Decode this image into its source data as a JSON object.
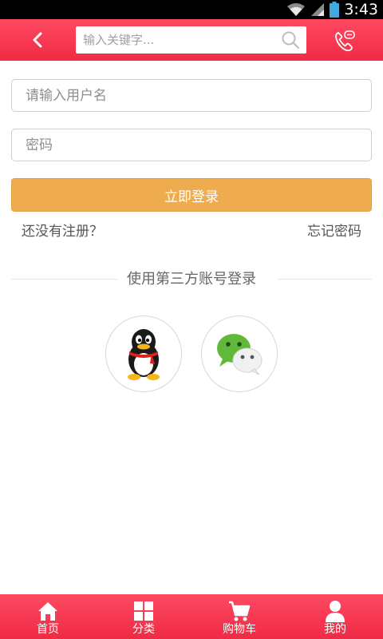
{
  "status_bar": {
    "time": "3:43"
  },
  "header": {
    "search_placeholder": "输入关键字...",
    "icons": [
      "back-arrow-icon",
      "search-icon",
      "phone-message-icon"
    ]
  },
  "form": {
    "username_placeholder": "请输入用户名",
    "password_placeholder": "密码",
    "login_label": "立即登录",
    "register_link": "还没有注册？",
    "forgot_link": "忘记密码"
  },
  "third_party": {
    "title": "使用第三方账号登录",
    "providers": [
      "qq-icon",
      "wechat-icon"
    ]
  },
  "bottom_nav": {
    "items": [
      {
        "label": "首页",
        "icon": "home-icon"
      },
      {
        "label": "分类",
        "icon": "category-grid-icon"
      },
      {
        "label": "购物车",
        "icon": "cart-icon"
      },
      {
        "label": "我的",
        "icon": "user-icon"
      }
    ]
  },
  "colors": {
    "header": "#f6354f",
    "login_button": "#efac4f",
    "nav": "#f6354f"
  }
}
